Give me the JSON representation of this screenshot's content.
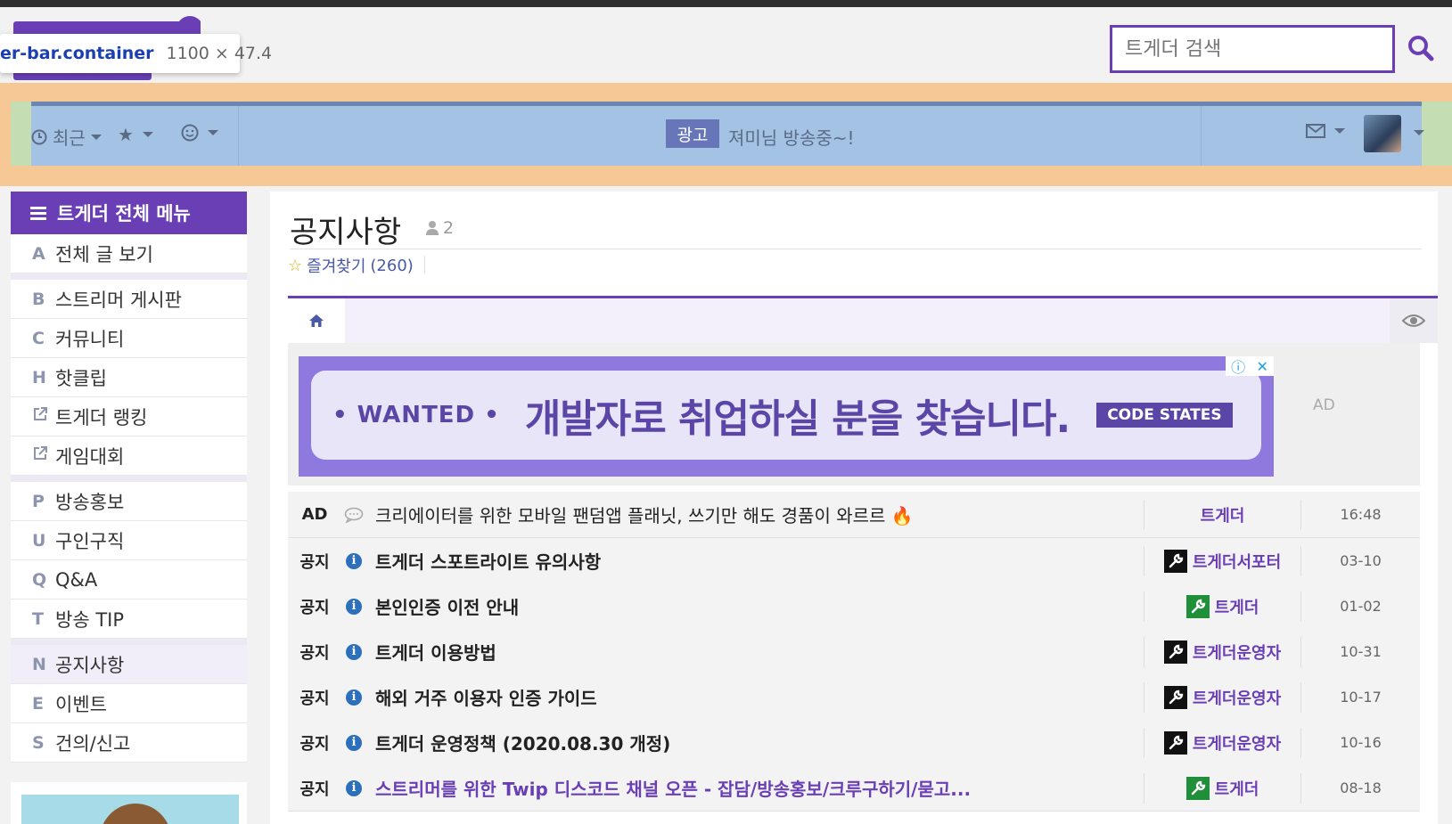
{
  "header": {
    "search_placeholder": "트게더 검색",
    "tooltip": {
      "selector": "er-bar.container",
      "size": "1100 × 47.4"
    }
  },
  "nav": {
    "recent_label": "최근",
    "ad_badge": "광고",
    "ad_text": "져미님 방송중~!"
  },
  "sidebar": {
    "title": "트게더 전체 메뉴",
    "groups": [
      [
        {
          "letter": "A",
          "label": "전체 글 보기"
        }
      ],
      [
        {
          "letter": "B",
          "label": "스트리머 게시판"
        },
        {
          "letter": "C",
          "label": "커뮤니티"
        },
        {
          "letter": "H",
          "label": "핫클립"
        },
        {
          "letter": "",
          "label": "트게더 랭킹",
          "icon": "external-link-icon"
        },
        {
          "letter": "",
          "label": "게임대회",
          "icon": "external-link-icon"
        }
      ],
      [
        {
          "letter": "P",
          "label": "방송홍보"
        },
        {
          "letter": "U",
          "label": "구인구직"
        },
        {
          "letter": "Q",
          "label": "Q&A"
        },
        {
          "letter": "T",
          "label": "방송 TIP"
        }
      ],
      [
        {
          "letter": "N",
          "label": "공지사항",
          "active": true
        },
        {
          "letter": "E",
          "label": "이벤트"
        },
        {
          "letter": "S",
          "label": "건의/신고"
        }
      ]
    ]
  },
  "main": {
    "title": "공지사항",
    "member_count": "2",
    "favorite_label": "즐겨찾기",
    "favorite_count": "(260)",
    "banner": {
      "brand": "• WANTED •",
      "message": "개발자로 취업하실 분을 찾습니다.",
      "partner": "CODE STATES"
    },
    "ad_label": "AD",
    "rows": [
      {
        "tag": "AD",
        "icon": "speech-bubble-icon",
        "title": "크리에이터를 위한 모바일 팬덤앱 플래닛, 쓰기만 해도 경품이 와르르 🔥",
        "bold": false,
        "link": false,
        "author": "트게더",
        "author_icon": "",
        "date": "16:48"
      },
      {
        "tag": "공지",
        "icon": "info-icon",
        "title": "트게더 스포트라이트 유의사항",
        "bold": true,
        "link": false,
        "author": "트게더서포터",
        "author_icon": "black",
        "date": "03-10"
      },
      {
        "tag": "공지",
        "icon": "info-icon",
        "title": "본인인증 이전 안내",
        "bold": true,
        "link": false,
        "author": "트게더",
        "author_icon": "green",
        "date": "01-02"
      },
      {
        "tag": "공지",
        "icon": "info-icon",
        "title": "트게더 이용방법",
        "bold": true,
        "link": false,
        "author": "트게더운영자",
        "author_icon": "black",
        "date": "10-31"
      },
      {
        "tag": "공지",
        "icon": "info-icon",
        "title": "해외 거주 이용자 인증 가이드",
        "bold": true,
        "link": false,
        "author": "트게더운영자",
        "author_icon": "black",
        "date": "10-17"
      },
      {
        "tag": "공지",
        "icon": "info-icon",
        "title": "트게더 운영정책 (2020.08.30 개정)",
        "bold": true,
        "link": false,
        "author": "트게더운영자",
        "author_icon": "black",
        "date": "10-16"
      },
      {
        "tag": "공지",
        "icon": "info-icon",
        "title": "스트리머를 위한 Twip 디스코드 채널 오픈 - 잡담/방송홍보/크루구하기/묻고...",
        "bold": true,
        "link": true,
        "author": "트게더",
        "author_icon": "green",
        "date": "08-18"
      }
    ]
  },
  "colors": {
    "brand": "#6a3fb5",
    "overlay_margin": "#f5c896",
    "overlay_padding": "#c5ddb3",
    "overlay_content": "#a3c2e4"
  }
}
